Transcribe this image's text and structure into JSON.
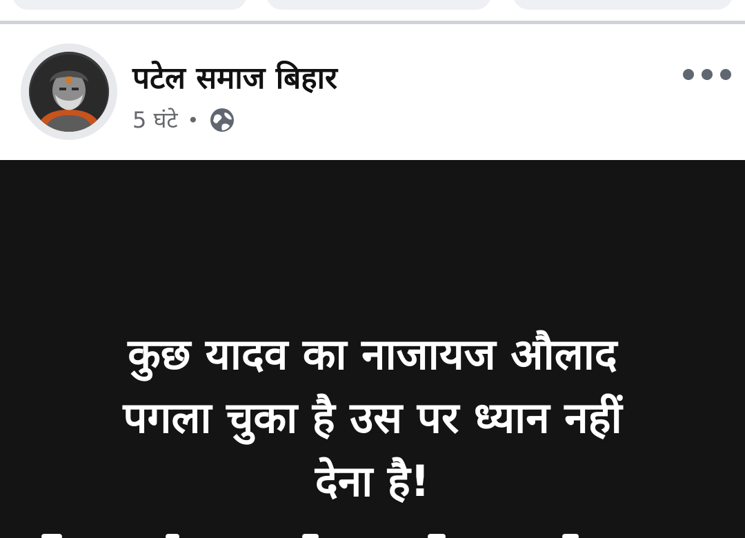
{
  "post": {
    "author": "पटेल समाज बिहार",
    "time": "5 घंटे",
    "separator": "•",
    "privacy_icon": "globe-icon",
    "menu_icon": "more-horizontal-icon",
    "avatar_icon": "profile-avatar-icon",
    "text": "कुछ यादव का नाजायज औलाद\nपगला चुका है उस पर ध्यान नहीं\nदेना है!"
  },
  "colors": {
    "post_background": "#141414",
    "post_text": "#ffffff",
    "meta_text": "#65676b",
    "divider": "#cfd2d6"
  }
}
